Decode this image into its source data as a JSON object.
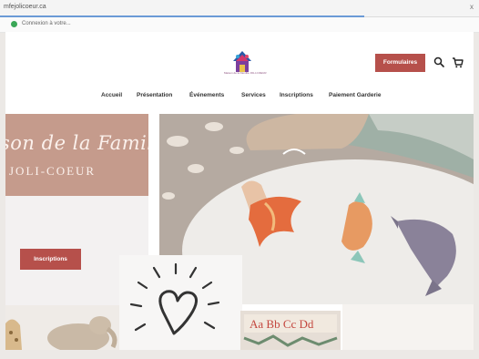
{
  "browser": {
    "url": "mfejolicoeur.ca",
    "close_glyph": "x",
    "notice_text": "Connexion à votre..."
  },
  "header": {
    "logo_caption": "Maison de la Famille JOLI-COEUR",
    "formulaires_label": "Formulaires",
    "search_icon": "search-icon",
    "cart_icon": "cart-icon"
  },
  "nav": {
    "items": [
      "Accueil",
      "Présentation",
      "Événements",
      "Services",
      "Inscriptions",
      "Paiement Garderie"
    ]
  },
  "hero": {
    "script_text": "son de la Famille",
    "caps_text": "JOLI-COEUR",
    "inscriptions_label": "Inscriptions",
    "alphabet_text": "Aa Bb Cc Dd"
  },
  "colors": {
    "accent": "#b6504b",
    "brand_block": "#c59b8c",
    "progress": "#6b9bd6"
  }
}
